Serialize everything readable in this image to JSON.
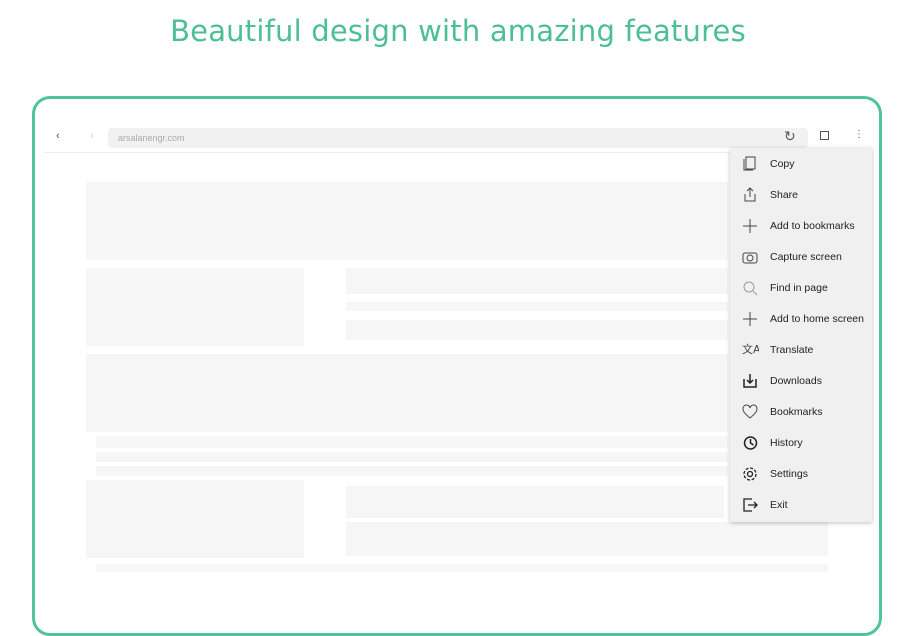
{
  "headline": "Beautiful design with amazing features",
  "colors": {
    "accent": "#4fc39a",
    "menu_bg": "#f0f0f0"
  },
  "browser": {
    "url": "arsalanengr.com",
    "back_icon": "chevron-left-icon",
    "forward_icon": "chevron-right-icon",
    "reload_icon": "reload-icon",
    "tabs_icon": "tabs-icon",
    "menu_icon": "more-vertical-icon"
  },
  "menu": {
    "items": [
      {
        "label": "Copy",
        "icon": "copy-icon"
      },
      {
        "label": "Share",
        "icon": "share-icon"
      },
      {
        "label": "Add to bookmarks",
        "icon": "plus-icon"
      },
      {
        "label": "Capture screen",
        "icon": "camera-icon"
      },
      {
        "label": "Find in page",
        "icon": "search-icon"
      },
      {
        "label": "Add to home screen",
        "icon": "plus-icon"
      },
      {
        "label": "Translate",
        "icon": "translate-icon"
      },
      {
        "label": "Downloads",
        "icon": "download-icon"
      },
      {
        "label": "Bookmarks",
        "icon": "heart-icon"
      },
      {
        "label": "History",
        "icon": "history-icon"
      },
      {
        "label": "Settings",
        "icon": "gear-icon"
      },
      {
        "label": "Exit",
        "icon": "exit-icon"
      }
    ]
  }
}
